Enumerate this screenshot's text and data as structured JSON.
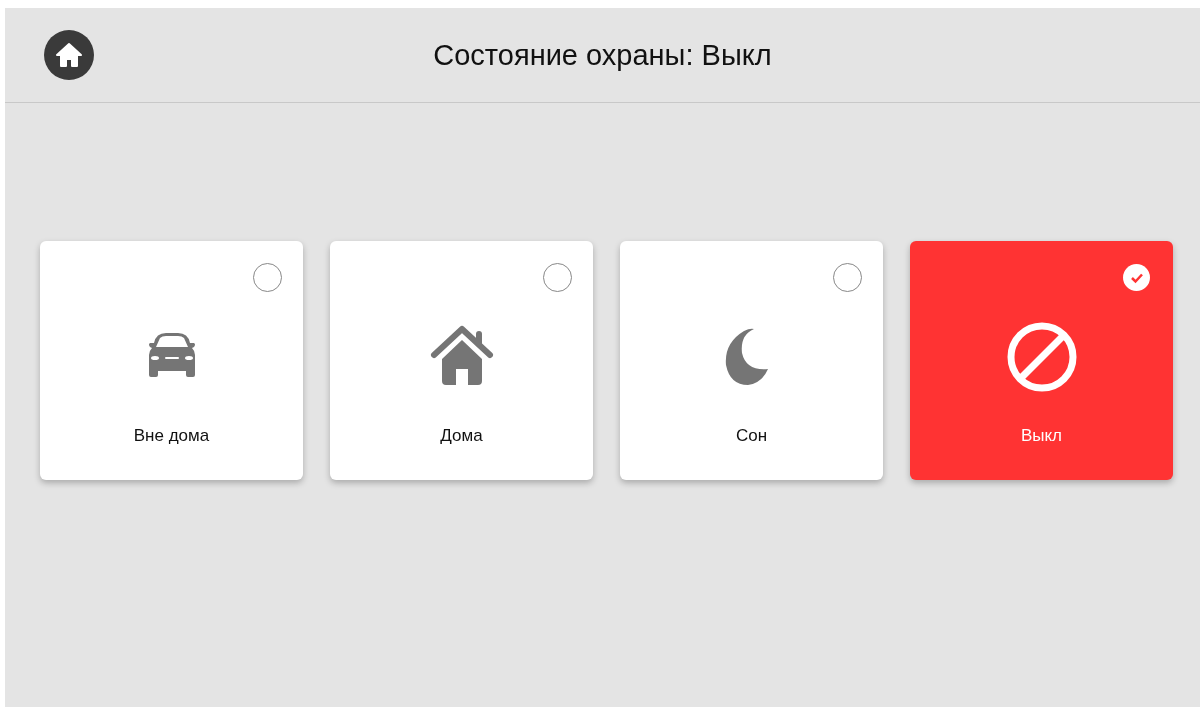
{
  "header": {
    "title": "Состояние охраны: Выкл"
  },
  "modes": [
    {
      "kind": "car",
      "label": "Вне дома",
      "selected": false
    },
    {
      "kind": "home",
      "label": "Дома",
      "selected": false
    },
    {
      "kind": "moon",
      "label": "Сон",
      "selected": false
    },
    {
      "kind": "off",
      "label": "Выкл",
      "selected": true
    }
  ]
}
